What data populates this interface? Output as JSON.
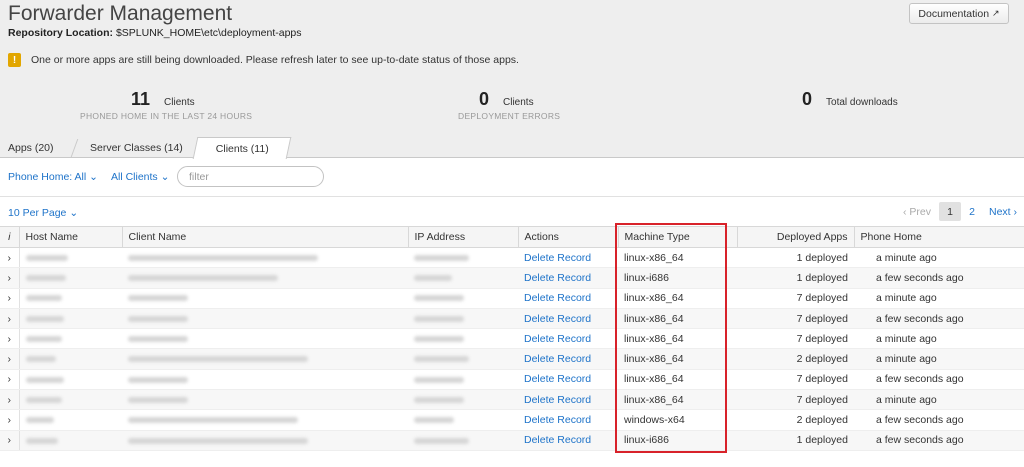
{
  "header": {
    "title": "Forwarder Management",
    "repo_label": "Repository Location:",
    "repo_path": "$SPLUNK_HOME\\etc\\deployment-apps",
    "doc_button": "Documentation"
  },
  "warning": {
    "icon": "!",
    "text": "One or more apps are still being downloaded. Please refresh later to see up-to-date status of those apps."
  },
  "stats": [
    {
      "num": "11",
      "label": "Clients",
      "sub": "PHONED HOME IN THE LAST 24 HOURS"
    },
    {
      "num": "0",
      "label": "Clients",
      "sub": "DEPLOYMENT ERRORS"
    },
    {
      "num": "0",
      "label": "Total downloads",
      "sub": ""
    }
  ],
  "tabs": [
    {
      "label": "Apps (20)"
    },
    {
      "label": "Server Classes (14)"
    },
    {
      "label": "Clients (11)"
    }
  ],
  "filters": {
    "phone_home": "Phone Home: All",
    "clients": "All Clients",
    "filter_placeholder": "filter"
  },
  "pagination": {
    "per_page": "10 Per Page",
    "prev": "Prev",
    "pages": [
      "1",
      "2"
    ],
    "next": "Next"
  },
  "table": {
    "columns": [
      "i",
      "Host Name",
      "Client Name",
      "IP Address",
      "Actions",
      "Machine Type",
      "Deployed Apps",
      "Phone Home"
    ],
    "rows": [
      {
        "action": "Delete Record",
        "machine": "linux-x86_64",
        "apps": "1 deployed",
        "phone": "a minute ago"
      },
      {
        "action": "Delete Record",
        "machine": "linux-i686",
        "apps": "1 deployed",
        "phone": "a few seconds ago"
      },
      {
        "action": "Delete Record",
        "machine": "linux-x86_64",
        "apps": "7 deployed",
        "phone": "a minute ago"
      },
      {
        "action": "Delete Record",
        "machine": "linux-x86_64",
        "apps": "7 deployed",
        "phone": "a few seconds ago"
      },
      {
        "action": "Delete Record",
        "machine": "linux-x86_64",
        "apps": "7 deployed",
        "phone": "a minute ago"
      },
      {
        "action": "Delete Record",
        "machine": "linux-x86_64",
        "apps": "2 deployed",
        "phone": "a minute ago"
      },
      {
        "action": "Delete Record",
        "machine": "linux-x86_64",
        "apps": "7 deployed",
        "phone": "a few seconds ago"
      },
      {
        "action": "Delete Record",
        "machine": "linux-x86_64",
        "apps": "7 deployed",
        "phone": "a minute ago"
      },
      {
        "action": "Delete Record",
        "machine": "windows-x64",
        "apps": "2 deployed",
        "phone": "a few seconds ago"
      },
      {
        "action": "Delete Record",
        "machine": "linux-i686",
        "apps": "1 deployed",
        "phone": "a few seconds ago"
      }
    ]
  },
  "colors": {
    "link": "#1e73c9",
    "highlight": "#d8222a",
    "warning": "#e2a600"
  }
}
